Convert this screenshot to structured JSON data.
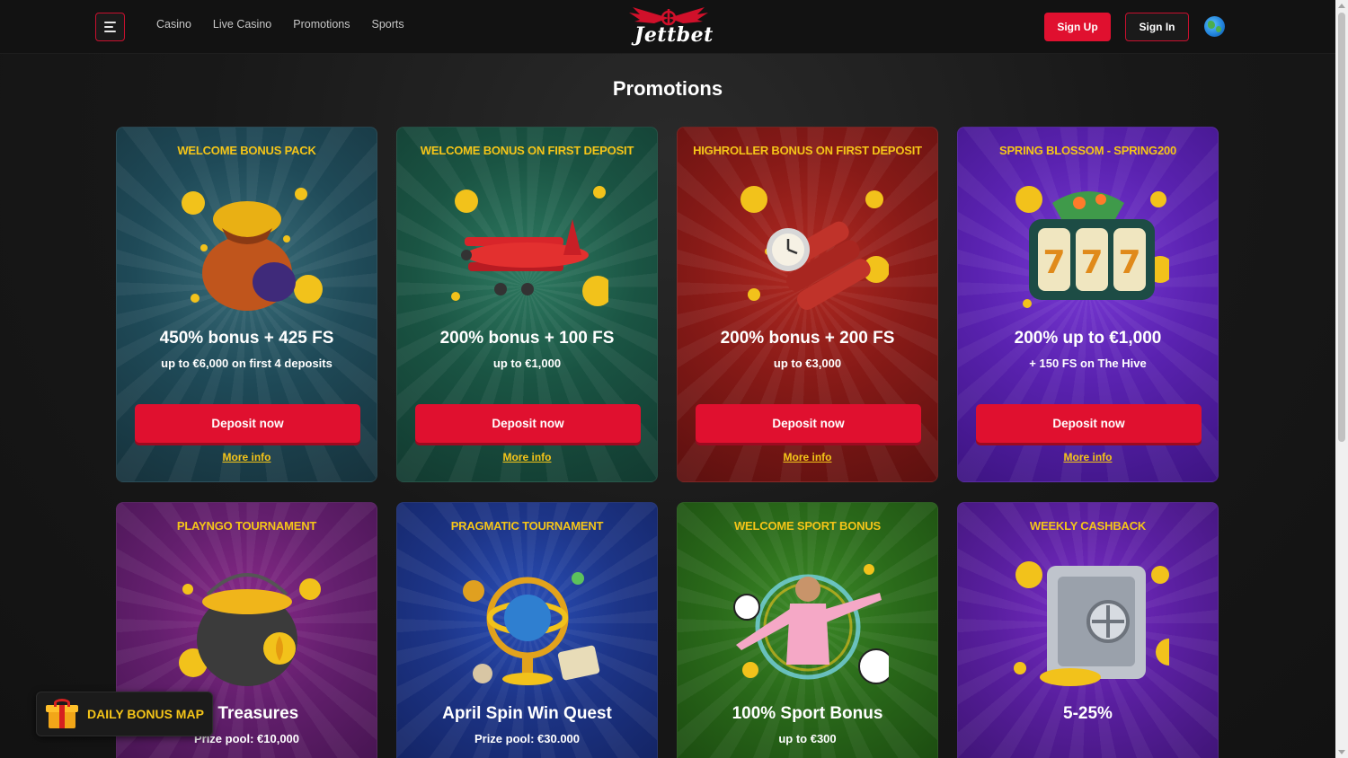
{
  "header": {
    "menu_icon": "hamburger-menu-icon",
    "nav": [
      "Casino",
      "Live Casino",
      "Promotions",
      "Sports"
    ],
    "logo_text": "Jettbet",
    "signup_label": "Sign Up",
    "signin_label": "Sign In",
    "language_icon": "globe-icon"
  },
  "page_title": "Promotions",
  "promotions": [
    {
      "title": "WELCOME BONUS PACK",
      "headline": "450% bonus + 425 FS",
      "sub": "up to €6,000 on first 4 deposits",
      "cta": "Deposit now",
      "more": "More info",
      "art": "gold-sack-icon",
      "theme": "#1f4a58"
    },
    {
      "title": "WELCOME BONUS ON FIRST DEPOSIT",
      "headline": "200% bonus + 100 FS",
      "sub": "up to €1,000",
      "cta": "Deposit now",
      "more": "More info",
      "art": "red-biplane-icon",
      "theme": "#1a5443"
    },
    {
      "title": "HIGHROLLER BONUS ON FIRST DEPOSIT",
      "headline": "200% bonus + 200 FS",
      "sub": "up to €3,000",
      "cta": "Deposit now",
      "more": "More info",
      "art": "dynamite-clock-icon",
      "theme": "#871a17"
    },
    {
      "title": "SPRING BLOSSOM - SPRING200",
      "headline": "200% up to €1,000",
      "sub": "+ 150 FS on The Hive",
      "cta": "Deposit now",
      "more": "More info",
      "art": "slot-machine-777-icon",
      "theme": "#5a22b0"
    },
    {
      "title": "PLAYNGO TOURNAMENT",
      "headline": "l's Treasures",
      "sub": "Prize pool: €10,000",
      "art": "pot-of-gold-icon",
      "theme": "#641f6e"
    },
    {
      "title": "PRAGMATIC TOURNAMENT",
      "headline": "April Spin Win Quest",
      "sub": "Prize pool: €30.000",
      "art": "armillary-globe-icon",
      "theme": "#1d3588"
    },
    {
      "title": "WELCOME SPORT BONUS",
      "headline": "100% Sport Bonus",
      "sub": "up to €300",
      "art": "football-player-icon",
      "theme": "#2a6a1a"
    },
    {
      "title": "WEEKLY CASHBACK",
      "headline": "5-25%",
      "sub": "",
      "art": "safe-vault-icon",
      "theme": "#5a1fa0"
    }
  ],
  "daily_bonus": {
    "label": "DAILY BONUS MAP",
    "icon": "gift-icon"
  }
}
